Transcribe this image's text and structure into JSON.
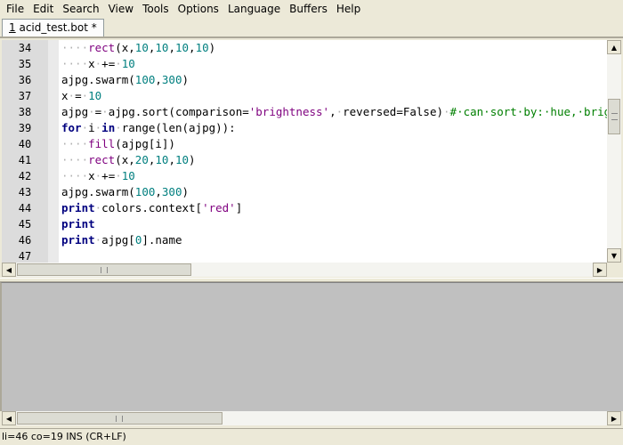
{
  "menu": [
    "File",
    "Edit",
    "Search",
    "View",
    "Tools",
    "Options",
    "Language",
    "Buffers",
    "Help"
  ],
  "tab": {
    "number": "1",
    "name": "acid_test.bot *"
  },
  "editor": {
    "line_numbers": [
      "34",
      "35",
      "36",
      "37",
      "38",
      "39",
      "40",
      "41",
      "42",
      "43",
      "44",
      "45",
      "46",
      "47"
    ],
    "lines": [
      [
        [
          "ws",
          "····"
        ],
        [
          "fn",
          "rect"
        ],
        [
          "",
          "(x,"
        ],
        [
          "num",
          "10"
        ],
        [
          "",
          ","
        ],
        [
          "num",
          "10"
        ],
        [
          "",
          ","
        ],
        [
          "num",
          "10"
        ],
        [
          "",
          ","
        ],
        [
          "num",
          "10"
        ],
        [
          "",
          ")"
        ]
      ],
      [
        [
          "ws",
          "····"
        ],
        [
          "",
          "x"
        ],
        [
          "ws",
          "·"
        ],
        [
          "",
          "+="
        ],
        [
          "ws",
          "·"
        ],
        [
          "num",
          "10"
        ]
      ],
      [
        [
          "",
          "ajpg.swarm("
        ],
        [
          "num",
          "100"
        ],
        [
          "",
          ","
        ],
        [
          "num",
          "300"
        ],
        [
          "",
          ")"
        ]
      ],
      [
        [
          "",
          "x"
        ],
        [
          "ws",
          "·"
        ],
        [
          "",
          "="
        ],
        [
          "ws",
          "·"
        ],
        [
          "num",
          "10"
        ]
      ],
      [
        [
          "",
          "ajpg"
        ],
        [
          "ws",
          "·"
        ],
        [
          "",
          "="
        ],
        [
          "ws",
          "·"
        ],
        [
          "",
          "ajpg.sort(comparison="
        ],
        [
          "str",
          "'brightness'"
        ],
        [
          "",
          ","
        ],
        [
          "ws",
          "·"
        ],
        [
          "",
          "reversed=False)"
        ],
        [
          "ws",
          "·"
        ],
        [
          "cmt",
          "#·can·sort·by:·hue,·brightness"
        ]
      ],
      [
        [
          "kw",
          "for"
        ],
        [
          "ws",
          "·"
        ],
        [
          "",
          "i"
        ],
        [
          "ws",
          "·"
        ],
        [
          "kw",
          "in"
        ],
        [
          "ws",
          "·"
        ],
        [
          "",
          "range(len(ajpg)):"
        ]
      ],
      [
        [
          "ws",
          "····"
        ],
        [
          "fn",
          "fill"
        ],
        [
          "",
          "(ajpg[i])"
        ]
      ],
      [
        [
          "ws",
          "····"
        ],
        [
          "fn",
          "rect"
        ],
        [
          "",
          "(x,"
        ],
        [
          "num",
          "20"
        ],
        [
          "",
          ","
        ],
        [
          "num",
          "10"
        ],
        [
          "",
          ","
        ],
        [
          "num",
          "10"
        ],
        [
          "",
          ")"
        ]
      ],
      [
        [
          "ws",
          "····"
        ],
        [
          "",
          "x"
        ],
        [
          "ws",
          "·"
        ],
        [
          "",
          "+="
        ],
        [
          "ws",
          "·"
        ],
        [
          "num",
          "10"
        ]
      ],
      [
        [
          "",
          "ajpg.swarm("
        ],
        [
          "num",
          "100"
        ],
        [
          "",
          ","
        ],
        [
          "num",
          "300"
        ],
        [
          "",
          ")"
        ]
      ],
      [
        [
          "kw",
          "print"
        ],
        [
          "ws",
          "·"
        ],
        [
          "",
          "colors.context["
        ],
        [
          "str",
          "'red'"
        ],
        [
          "",
          "]"
        ]
      ],
      [
        [
          "kw",
          "print"
        ]
      ],
      [
        [
          "kw",
          "print"
        ],
        [
          "ws",
          "·"
        ],
        [
          "",
          "ajpg["
        ],
        [
          "num",
          "0"
        ],
        [
          "",
          "].name"
        ]
      ],
      [
        [
          "",
          ""
        ]
      ]
    ]
  },
  "icons": {
    "scroll_up": "▲",
    "scroll_down": "▼",
    "scroll_left": "◀",
    "scroll_right": "▶"
  },
  "status": "li=46 co=19 INS (CR+LF)"
}
